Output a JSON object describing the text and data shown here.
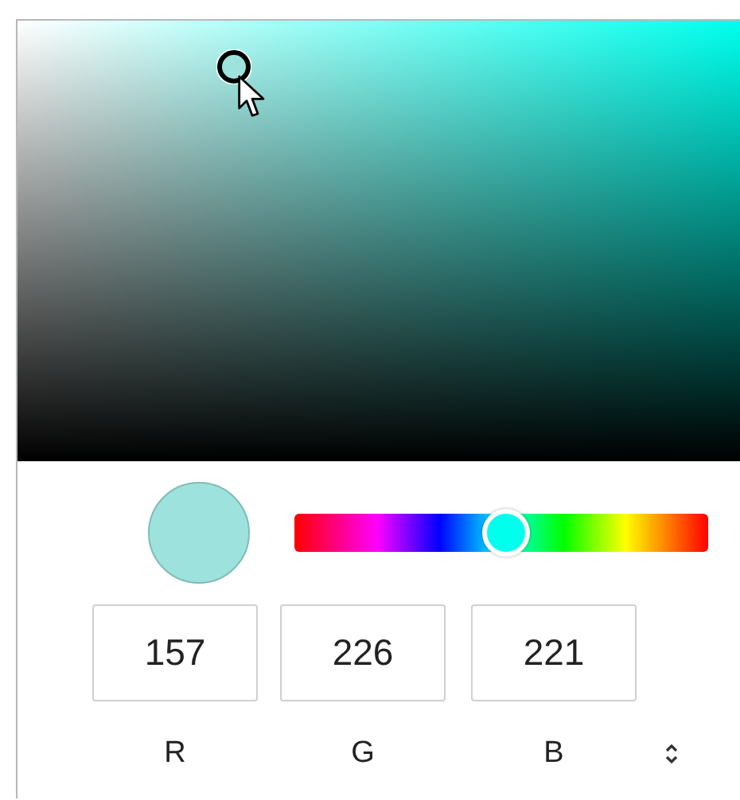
{
  "hue_slider": {
    "level": 0.51
  },
  "channels": [
    {
      "label": "R",
      "value": "157"
    },
    {
      "label": "G",
      "value": "226"
    },
    {
      "label": "B",
      "value": "221"
    }
  ]
}
